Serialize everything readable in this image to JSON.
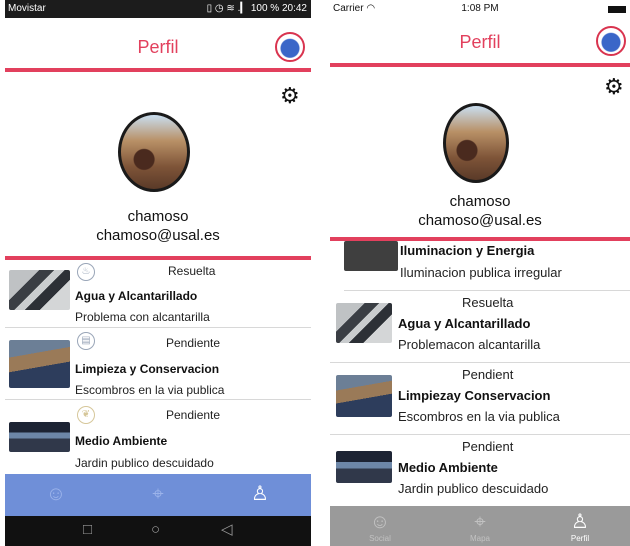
{
  "android": {
    "status_bar": {
      "carrier": "Movistar",
      "icons": "▯ ◷ ≋ .▎",
      "battery": "100 %",
      "time": "20:42"
    },
    "header": {
      "title": "Perfil"
    },
    "profile": {
      "name": "chamoso",
      "email": "chamoso@usal.es"
    },
    "incidents": [
      {
        "status": "Resuelta",
        "category": "Agua y Alcantarillado",
        "description": "Problema con alcantarilla"
      },
      {
        "status": "Pendiente",
        "category": "Limpieza y Conservacion",
        "description": "Escombros en la via publica"
      },
      {
        "status": "Pendiente",
        "category": "Medio Ambiente",
        "description": "Jardin publico descuidado"
      }
    ],
    "tabs": [
      {
        "icon": "social-icon"
      },
      {
        "icon": "map-pin-icon"
      },
      {
        "icon": "user-icon",
        "active": true
      }
    ],
    "navigation": {
      "recents": "□",
      "home": "○",
      "back": "◁"
    }
  },
  "ios": {
    "status_bar": {
      "carrier": "Carrier",
      "time": "1:08 PM"
    },
    "header": {
      "title": "Perfil"
    },
    "profile": {
      "name": "chamoso",
      "email": "chamoso@usal.es"
    },
    "incidents": [
      {
        "category": "Iluminacion y Energia",
        "description": "Iluminacion publica irregular"
      },
      {
        "status": "Resuelta",
        "category": "Agua y Alcantarillado",
        "description": "Problemacon alcantarilla"
      },
      {
        "status": "Pendient",
        "category": "Limpiezay Conservacion",
        "description": "Escombros en la via publica"
      },
      {
        "status": "Pendient",
        "category": "Medio Ambiente",
        "description": "Jardin publico descuidado"
      }
    ],
    "tabs": [
      {
        "label": "Social",
        "icon": "social-icon"
      },
      {
        "label": "Mapa",
        "icon": "map-pin-icon"
      },
      {
        "label": "Perfil",
        "icon": "user-icon",
        "active": true
      }
    ]
  },
  "colors": {
    "accent": "#e2405d",
    "android_tabbar": "#6f8fd8",
    "ios_tabbar": "#9a9a9a"
  }
}
